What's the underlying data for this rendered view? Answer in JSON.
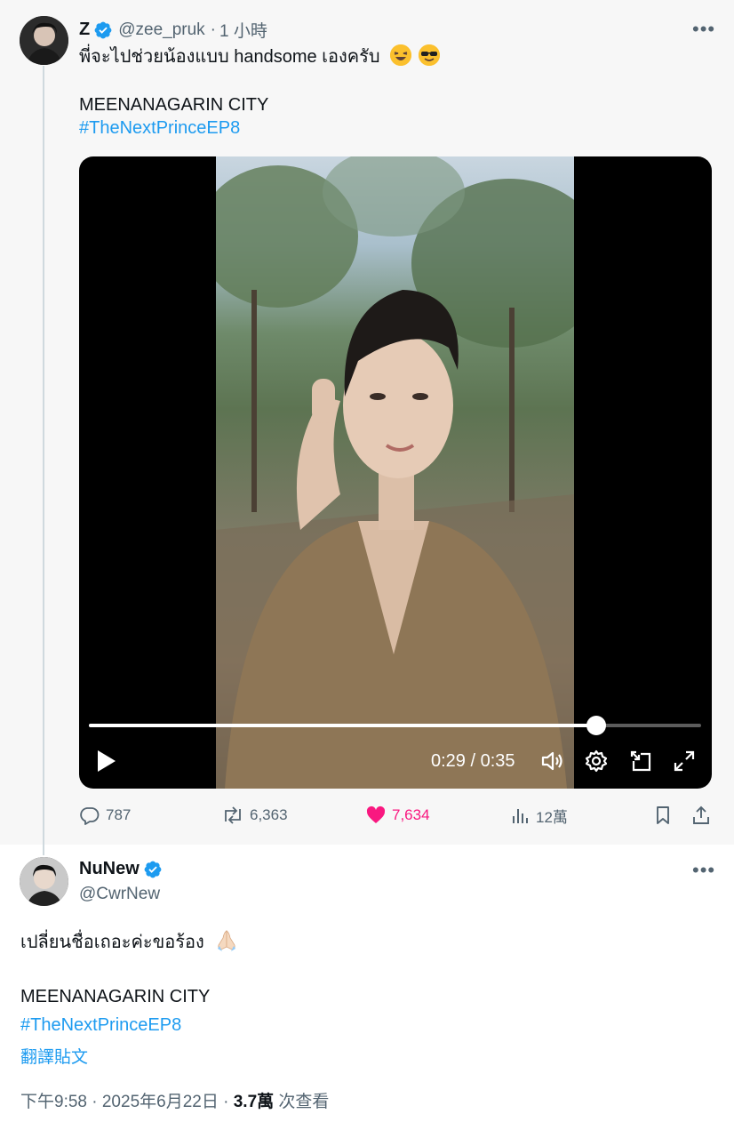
{
  "parent_tweet": {
    "name": "Z",
    "handle": "@zee_pruk",
    "separator": "·",
    "time": "1 小時",
    "text_line1": "พี่จะไปช่วยน้องแบบ handsome เองครับ",
    "emojis": [
      "grinning-squinting-face",
      "smiling-face-with-sunglasses"
    ],
    "text_line2": "MEENANAGARIN CITY",
    "hashtag": "#TheNextPrinceEP8",
    "video": {
      "time_display": "0:29 / 0:35",
      "progress": 0.8286
    },
    "actions": {
      "replies": "787",
      "reposts": "6,363",
      "likes": "7,634",
      "views": "12萬"
    }
  },
  "reply_tweet": {
    "name": "NuNew",
    "handle": "@CwrNew",
    "text_line1": "เปลี่ยนชื่อเถอะค่ะขอร้อง",
    "emoji": "folded-hands",
    "text_line2": "MEENANAGARIN CITY",
    "hashtag": "#TheNextPrinceEP8",
    "translate_label": "翻譯貼文",
    "timestamp": "下午9:58 · 2025年6月22日 · ",
    "views_count": "3.7萬",
    "views_label": " 次查看"
  },
  "colors": {
    "accent": "#1d9bf0",
    "like": "#f91880",
    "secondary_text": "#536471",
    "verified": "#1d9bf0"
  }
}
